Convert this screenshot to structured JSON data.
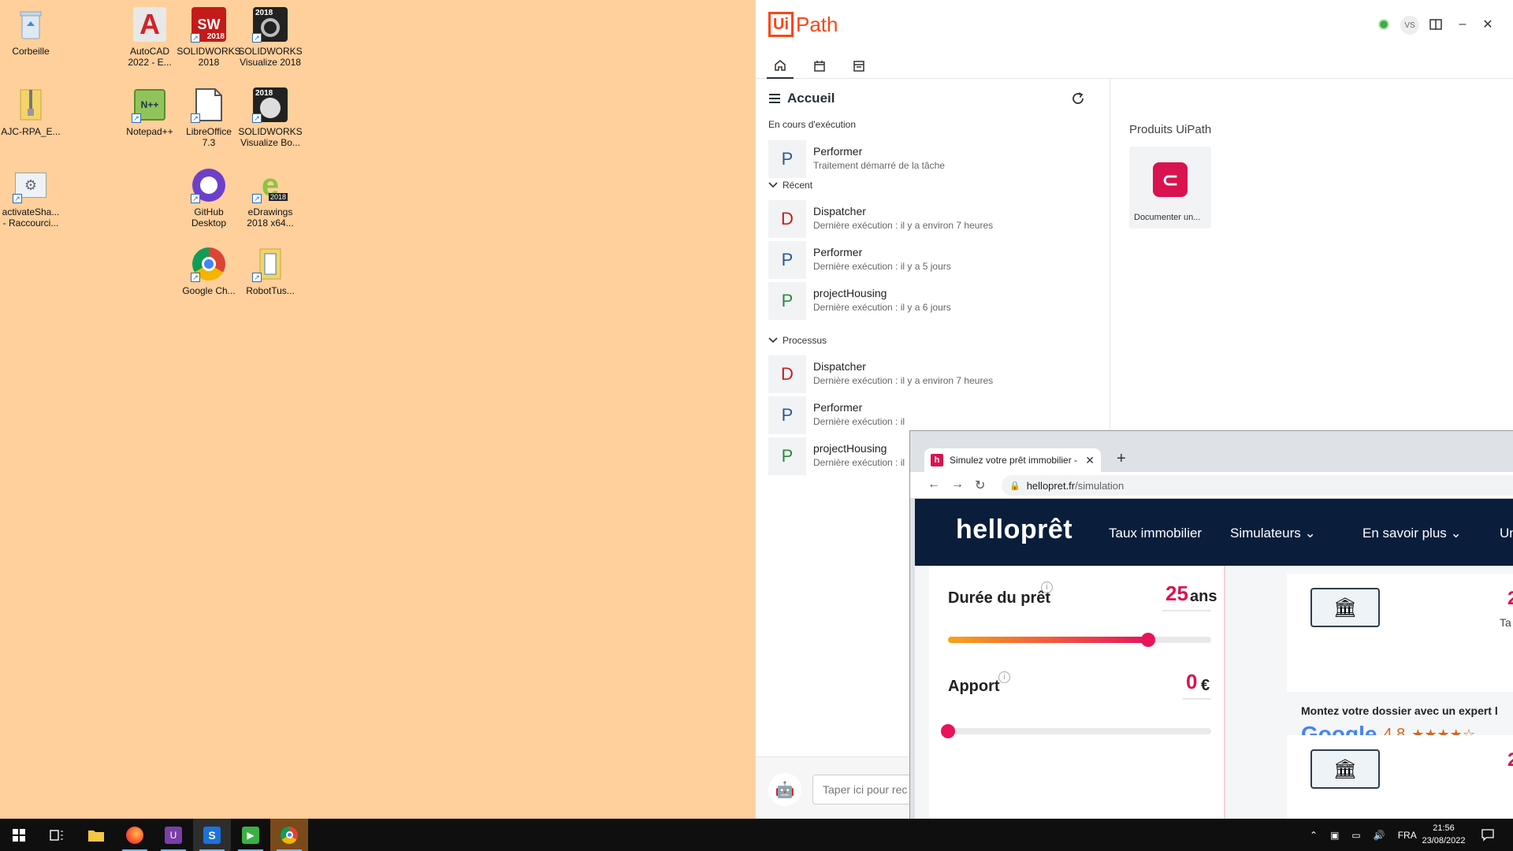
{
  "desktop": {
    "icons": [
      {
        "id": "recycle",
        "label": "Corbeille"
      },
      {
        "id": "autocad",
        "label": "AutoCAD\n2022 - E..."
      },
      {
        "id": "sw2018",
        "label": "SOLIDWORKS\n2018"
      },
      {
        "id": "swvis",
        "label": "SOLIDWORKS\nVisualize 2018"
      },
      {
        "id": "ajc",
        "label": "AJC-RPA_E..."
      },
      {
        "id": "notepadpp",
        "label": "Notepad++"
      },
      {
        "id": "libreoffice",
        "label": "LibreOffice\n7.3"
      },
      {
        "id": "swvisbo",
        "label": "SOLIDWORKS\nVisualize Bo..."
      },
      {
        "id": "activatesha",
        "label": "activateSha...\n- Raccourci..."
      },
      {
        "id": "github",
        "label": "GitHub\nDesktop"
      },
      {
        "id": "edrawings",
        "label": "eDrawings\n2018 x64..."
      },
      {
        "id": "chrome",
        "label": "Google Ch..."
      },
      {
        "id": "robottus",
        "label": "RobotTus..."
      }
    ],
    "badge_2018": "2018",
    "sw_text": "SW"
  },
  "uipath": {
    "logo_ui": "Ui",
    "logo_path": "Path",
    "avatar": "VS",
    "home": {
      "title": "Accueil",
      "running_label": "En cours d'exécution",
      "running": [
        {
          "letter": "P",
          "name": "Performer",
          "sub": "Traitement démarré de la tâche"
        }
      ],
      "recent_label": "Récent",
      "recent": [
        {
          "letter": "D",
          "name": "Dispatcher",
          "sub": "Dernière exécution : il y a environ 7 heures"
        },
        {
          "letter": "P",
          "name": "Performer",
          "sub": "Dernière exécution : il y a 5 jours"
        },
        {
          "letter": "P",
          "name": "projectHousing",
          "sub": "Dernière exécution : il y a 6 jours"
        }
      ],
      "processes_label": "Processus",
      "processes": [
        {
          "letter": "D",
          "name": "Dispatcher",
          "sub": "Dernière exécution : il y a environ 7 heures"
        },
        {
          "letter": "P",
          "name": "Performer",
          "sub": "Dernière exécution : il"
        },
        {
          "letter": "P",
          "name": "projectHousing",
          "sub": "Dernière exécution : il"
        }
      ]
    },
    "products": {
      "title": "Produits UiPath",
      "card_label": "Documenter un..."
    },
    "chat": {
      "placeholder": "Taper ici pour rec"
    }
  },
  "chrome": {
    "tab_title": "Simulez votre prêt immobilier - S",
    "favicon": "h",
    "url_host": "hellopret.fr",
    "url_path": "/simulation",
    "site": {
      "logo": "helloprêt",
      "nav": [
        "Taux immobilier",
        "Simulateurs",
        "En savoir plus",
        "Uni"
      ],
      "duration_label": "Durée du prêt",
      "duration_value": "25",
      "duration_unit": "ans",
      "duration_level": 0.76,
      "apport_label": "Apport",
      "apport_value": "0",
      "apport_unit": "€",
      "apport_level": 0.0,
      "expert_text": "Montez votre dossier avec un expert l",
      "google": "Google",
      "rating": "4,8",
      "card_num_1": "2",
      "card_partial_1": "Ta",
      "card_num_2": "2"
    }
  },
  "taskbar": {
    "lang": "FRA",
    "time": "21:56",
    "date": "23/08/2022"
  }
}
